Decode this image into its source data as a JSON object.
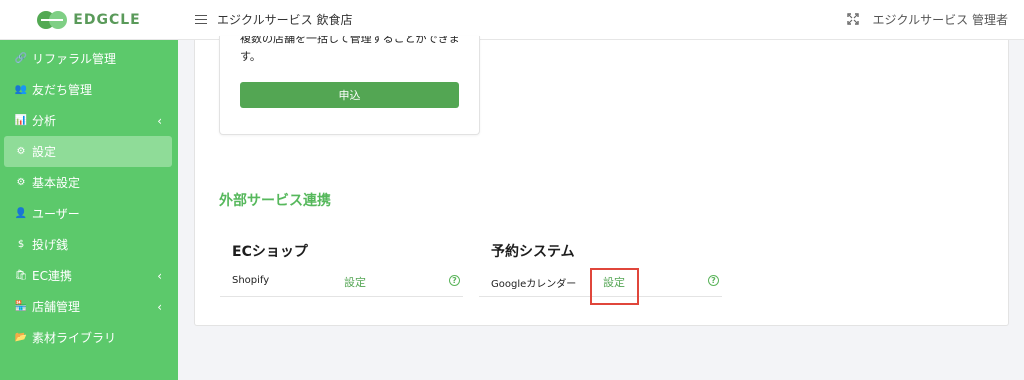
{
  "brand": {
    "name": "EDGCLE"
  },
  "sidebar": {
    "items": [
      {
        "label": "リファラル管理",
        "icon": "link-icon",
        "glyph": "🔗",
        "caret": false,
        "active": false
      },
      {
        "label": "友だち管理",
        "icon": "users-icon",
        "glyph": "👥",
        "caret": false,
        "active": false
      },
      {
        "label": "分析",
        "icon": "chart-icon",
        "glyph": "📊",
        "caret": true,
        "active": false
      },
      {
        "label": "設定",
        "icon": "gear-icon",
        "glyph": "⚙",
        "caret": false,
        "active": true
      },
      {
        "label": "基本設定",
        "icon": "gear-icon",
        "glyph": "⚙",
        "caret": false,
        "active": false
      },
      {
        "label": "ユーザー",
        "icon": "user-icon",
        "glyph": "👤",
        "caret": false,
        "active": false
      },
      {
        "label": "投げ銭",
        "icon": "dollar-icon",
        "glyph": "$",
        "caret": false,
        "active": false
      },
      {
        "label": "EC連携",
        "icon": "shopping-bag-icon",
        "glyph": "🛍",
        "caret": true,
        "active": false
      },
      {
        "label": "店舗管理",
        "icon": "store-icon",
        "glyph": "🏪",
        "caret": true,
        "active": false
      },
      {
        "label": "素材ライブラリ",
        "icon": "folder-icon",
        "glyph": "📂",
        "caret": false,
        "active": false
      }
    ],
    "caret_glyph": "‹"
  },
  "topbar": {
    "title": "エジクルサービス 飲食店",
    "user": "エジクルサービス 管理者"
  },
  "plan": {
    "description": "複数の店舗を一括して管理することができます。",
    "apply_label": "申込"
  },
  "external": {
    "title": "外部サービス連携",
    "ec": {
      "heading": "ECショップ",
      "service": "Shopify",
      "link": "設定"
    },
    "reservation": {
      "heading": "予約システム",
      "service": "Googleカレンダー",
      "link": "設定"
    },
    "help_glyph": "?"
  },
  "colors": {
    "sidebar": "#5cc96b",
    "accent": "#53a653",
    "highlight": "#e0463b"
  }
}
